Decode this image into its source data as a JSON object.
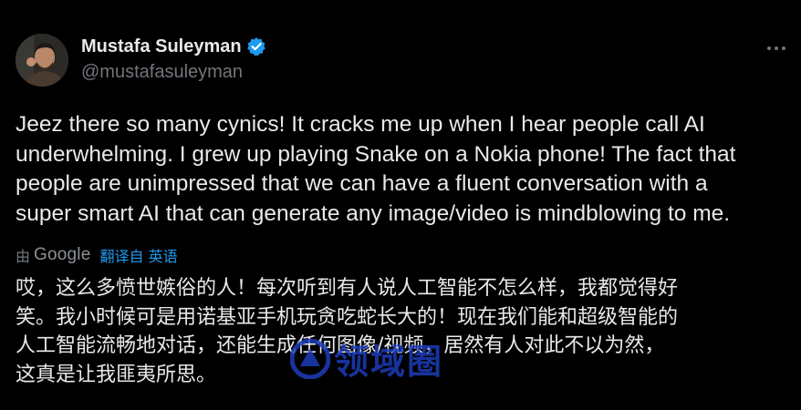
{
  "author": {
    "display_name": "Mustafa Suleyman",
    "handle": "@mustafasuleyman",
    "verified": true,
    "avatar_icon": "profile-photo"
  },
  "tweet": {
    "lines": [
      "Jeez there so many cynics! It cracks me up when I hear people call AI",
      "underwhelming. I grew up playing Snake on a Nokia phone! The fact that",
      "people are unimpressed that we can have a fluent conversation with a",
      "super smart AI that can generate any image/video is mindblowing to me."
    ]
  },
  "translation": {
    "by_label": "由",
    "provider": "Google",
    "link_text": "翻译自 英语",
    "lines": [
      "哎，这么多愤世嫉俗的人！每次听到有人说人工智能不怎么样，我都觉得好",
      "笑。我小时候可是用诺基亚手机玩贪吃蛇长大的！现在我们能和超级智能的",
      "人工智能流畅地对话，还能生成任何图像/视频，居然有人对此不以为然，",
      "这真是让我匪夷所思。"
    ]
  },
  "watermark": {
    "text": "领域圈"
  },
  "colors": {
    "background": "#000000",
    "text": "#e7e9ea",
    "secondary": "#71767b",
    "accent": "#1d9bf0",
    "watermark": "#1e3fbf"
  }
}
